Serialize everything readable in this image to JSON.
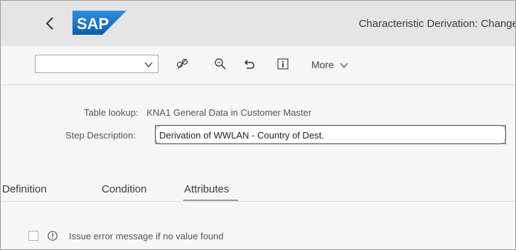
{
  "header": {
    "logo_text": "SAP",
    "title": "Characteristic Derivation: Change"
  },
  "toolbar": {
    "combo_value": "",
    "more_label": "More"
  },
  "form": {
    "table_lookup_label": "Table lookup:",
    "table_lookup_value": "KNA1 General Data in Customer Master",
    "step_description_label": "Step Description:",
    "step_description_value": "Derivation of WWLAN - Country of Dest."
  },
  "tabs": [
    {
      "label": "Definition"
    },
    {
      "label": "Condition"
    },
    {
      "label": "Attributes",
      "selected": true
    }
  ],
  "options": {
    "issue_error_label": "Issue error message if no value found",
    "issue_error_checked": false
  },
  "colors": {
    "header_bg": "#e5e5e5",
    "logo_blue": "#1a73c7",
    "page_bg": "#f7f7f7"
  }
}
